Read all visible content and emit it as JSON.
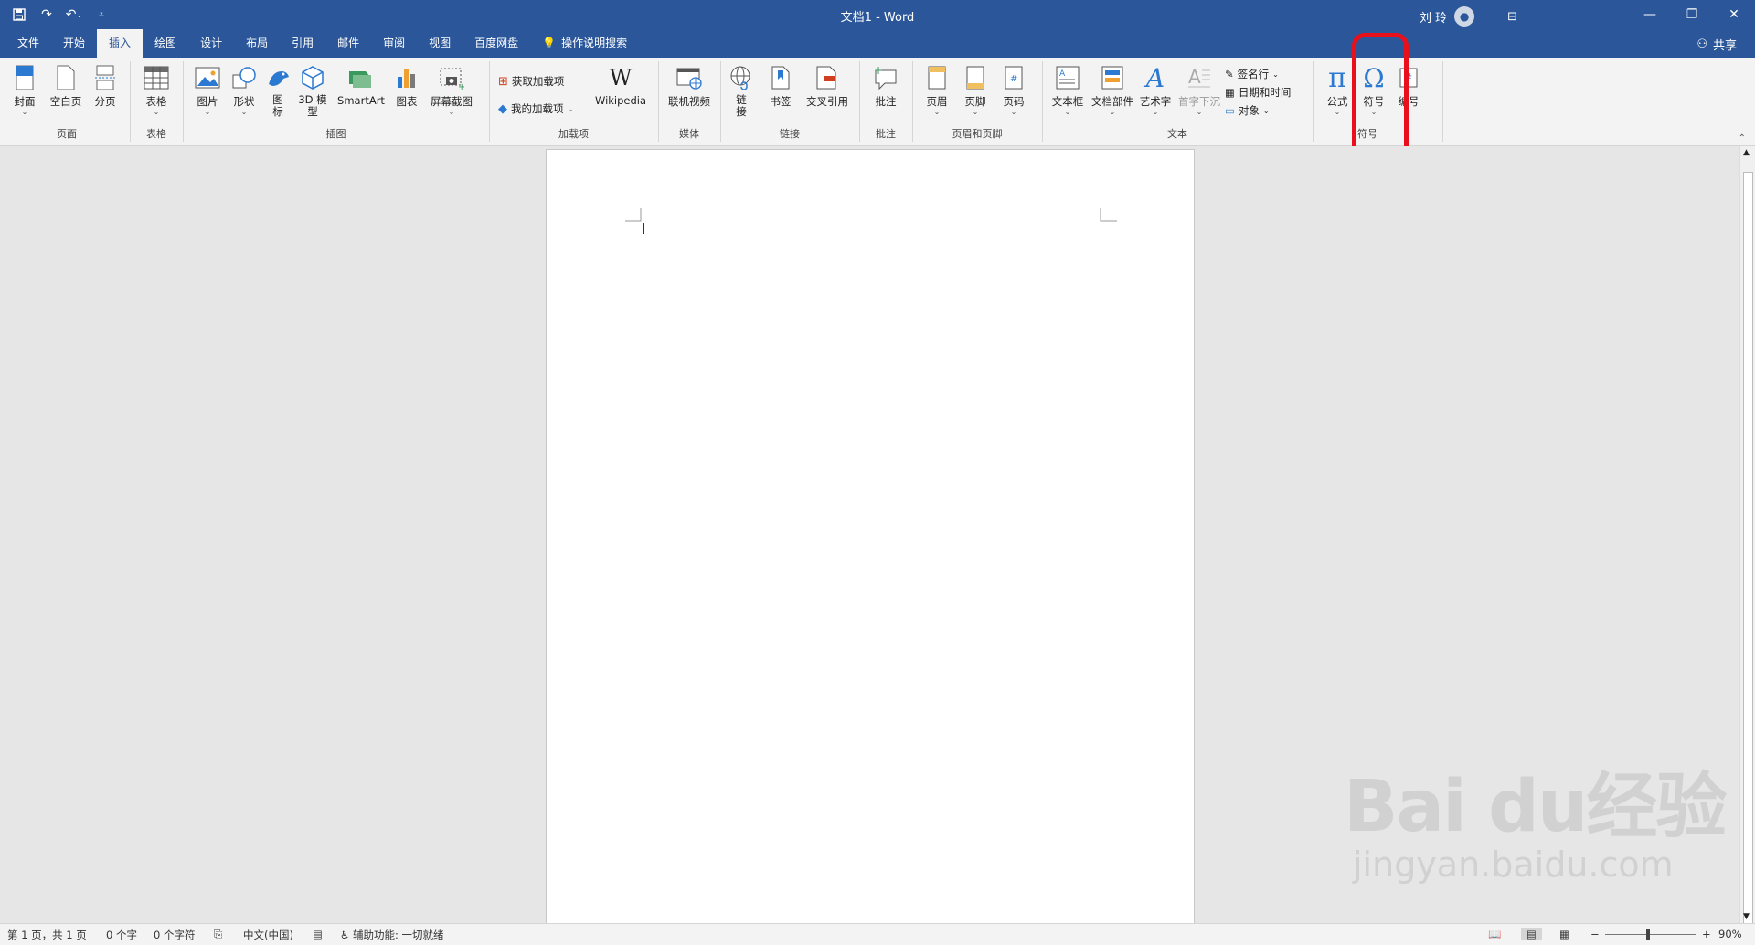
{
  "title_bar": {
    "document_title": "文档1  -  Word",
    "user_name": "刘 玲"
  },
  "tabs": [
    "文件",
    "开始",
    "插入",
    "绘图",
    "设计",
    "布局",
    "引用",
    "邮件",
    "审阅",
    "视图",
    "百度网盘"
  ],
  "active_tab": "插入",
  "search_label": "操作说明搜索",
  "share_label": "共享",
  "ribbon": {
    "pages": {
      "label": "页面",
      "cover": "封面",
      "blank": "空白页",
      "break": "分页"
    },
    "tables": {
      "label": "表格",
      "table": "表格"
    },
    "illustrations": {
      "label": "插图",
      "pictures": "图片",
      "shapes": "形状",
      "icons": "图\n标",
      "model3d": "3D 模\n型",
      "smartart": "SmartArt",
      "chart": "图表",
      "screenshot": "屏幕截图"
    },
    "addins": {
      "label": "加载项",
      "get": "获取加载项",
      "my": "我的加载项",
      "wikipedia": "Wikipedia"
    },
    "media": {
      "label": "媒体",
      "online_video": "联机视频"
    },
    "links": {
      "label": "链接",
      "link": "链\n接",
      "bookmark": "书签",
      "cross_ref": "交叉引用"
    },
    "comments": {
      "label": "批注",
      "comment": "批注"
    },
    "header_footer": {
      "label": "页眉和页脚",
      "header": "页眉",
      "footer": "页脚",
      "page_number": "页码"
    },
    "text": {
      "label": "文本",
      "textbox": "文本框",
      "quick_parts": "文档部件",
      "wordart": "艺术字",
      "dropcap": "首字下沉",
      "signature": "签名行",
      "datetime": "日期和时间",
      "object": "对象"
    },
    "symbols": {
      "label": "符号",
      "equation": "公式",
      "symbol": "符号",
      "number": "编号"
    }
  },
  "status_bar": {
    "page": "第 1 页，共 1 页",
    "words": "0 个字",
    "chars": "0 个字符",
    "language": "中文(中国)",
    "accessibility": "辅助功能: 一切就绪",
    "zoom": "90%"
  },
  "watermark": {
    "brand": "Bai  du经验",
    "url": "jingyan.baidu.com"
  },
  "colors": {
    "title_blue": "#2b579a",
    "highlight_red": "#e8101b"
  }
}
